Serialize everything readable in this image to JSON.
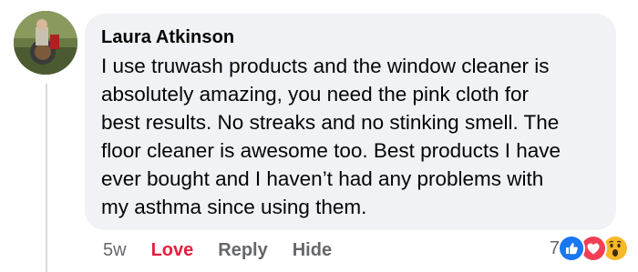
{
  "comment": {
    "author": "Laura Atkinson",
    "lines": [
      "I use truwash products and the window cleaner is",
      "absolutely amazing, you need the pink cloth for",
      "best results. No streaks and no stinking smell. The",
      "floor cleaner is awesome too. Best products I have",
      "ever bought and I haven’t had any problems with",
      "my asthma since using them."
    ]
  },
  "actions": {
    "time": "5w",
    "love_label": "Love",
    "reply_label": "Reply",
    "hide_label": "Hide"
  },
  "reactions": {
    "count": "7",
    "icons": [
      "like-icon",
      "love-icon",
      "wow-icon"
    ]
  },
  "colors": {
    "bubble": "#f0f2f5",
    "love": "#e41e3f",
    "muted": "#65676b",
    "like_blue": "#1877f2"
  }
}
